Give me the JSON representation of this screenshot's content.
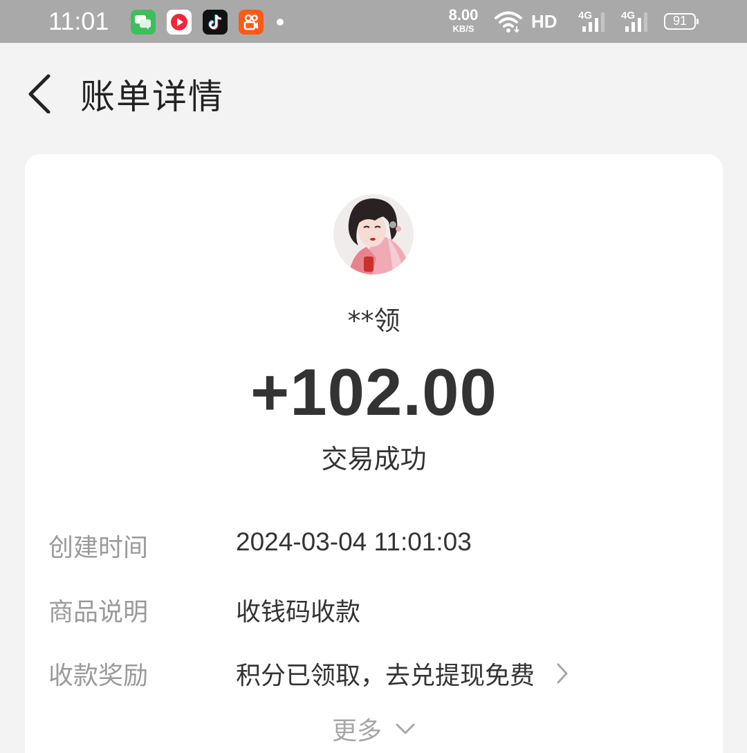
{
  "status_bar": {
    "time": "11:01",
    "net_speed_value": "8.00",
    "net_speed_unit": "KB/S",
    "hd_label": "HD",
    "signal_label_1": "4G",
    "signal_label_2": "4G",
    "battery": "91",
    "notification_icons": [
      "messages-app-icon",
      "video-app-icon",
      "tiktok-app-icon",
      "kuaishou-app-icon"
    ]
  },
  "header": {
    "title": "账单详情"
  },
  "bill": {
    "payer_name": "**领",
    "amount": "+102.00",
    "status": "交易成功",
    "details": [
      {
        "label": "创建时间",
        "value": "2024-03-04 11:01:03"
      },
      {
        "label": "商品说明",
        "value": "收钱码收款"
      },
      {
        "label": "收款奖励",
        "value": "积分已领取，去兑提现免费"
      }
    ],
    "more_label": "更多"
  },
  "colors": {
    "status_bar_bg": "#a9a9a9",
    "page_bg": "#f3f3f3",
    "card_bg": "#ffffff",
    "primary_text": "#333333",
    "secondary_text": "#9a9a9a"
  }
}
